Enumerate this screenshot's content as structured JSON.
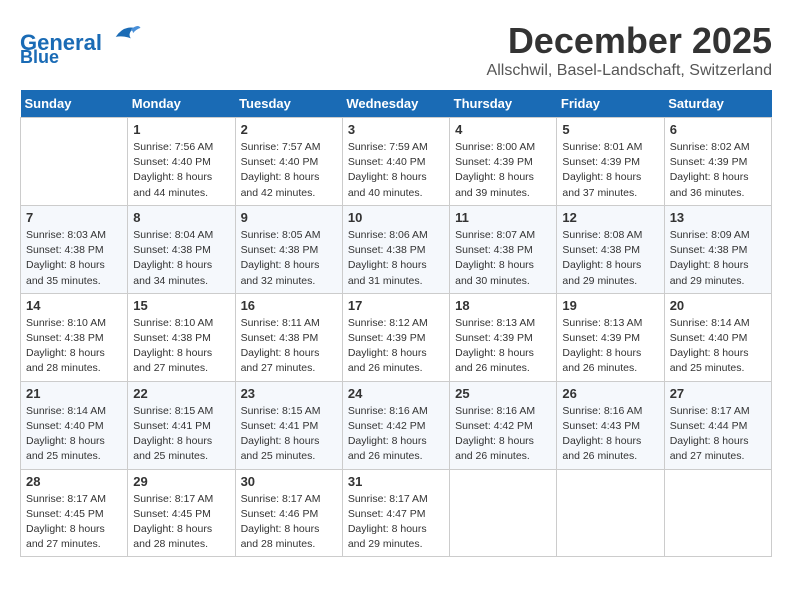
{
  "logo": {
    "line1": "General",
    "line2": "Blue"
  },
  "title": "December 2025",
  "location": "Allschwil, Basel-Landschaft, Switzerland",
  "days_of_week": [
    "Sunday",
    "Monday",
    "Tuesday",
    "Wednesday",
    "Thursday",
    "Friday",
    "Saturday"
  ],
  "weeks": [
    [
      {
        "day": "",
        "info": ""
      },
      {
        "day": "1",
        "info": "Sunrise: 7:56 AM\nSunset: 4:40 PM\nDaylight: 8 hours\nand 44 minutes."
      },
      {
        "day": "2",
        "info": "Sunrise: 7:57 AM\nSunset: 4:40 PM\nDaylight: 8 hours\nand 42 minutes."
      },
      {
        "day": "3",
        "info": "Sunrise: 7:59 AM\nSunset: 4:40 PM\nDaylight: 8 hours\nand 40 minutes."
      },
      {
        "day": "4",
        "info": "Sunrise: 8:00 AM\nSunset: 4:39 PM\nDaylight: 8 hours\nand 39 minutes."
      },
      {
        "day": "5",
        "info": "Sunrise: 8:01 AM\nSunset: 4:39 PM\nDaylight: 8 hours\nand 37 minutes."
      },
      {
        "day": "6",
        "info": "Sunrise: 8:02 AM\nSunset: 4:39 PM\nDaylight: 8 hours\nand 36 minutes."
      }
    ],
    [
      {
        "day": "7",
        "info": "Sunrise: 8:03 AM\nSunset: 4:38 PM\nDaylight: 8 hours\nand 35 minutes."
      },
      {
        "day": "8",
        "info": "Sunrise: 8:04 AM\nSunset: 4:38 PM\nDaylight: 8 hours\nand 34 minutes."
      },
      {
        "day": "9",
        "info": "Sunrise: 8:05 AM\nSunset: 4:38 PM\nDaylight: 8 hours\nand 32 minutes."
      },
      {
        "day": "10",
        "info": "Sunrise: 8:06 AM\nSunset: 4:38 PM\nDaylight: 8 hours\nand 31 minutes."
      },
      {
        "day": "11",
        "info": "Sunrise: 8:07 AM\nSunset: 4:38 PM\nDaylight: 8 hours\nand 30 minutes."
      },
      {
        "day": "12",
        "info": "Sunrise: 8:08 AM\nSunset: 4:38 PM\nDaylight: 8 hours\nand 29 minutes."
      },
      {
        "day": "13",
        "info": "Sunrise: 8:09 AM\nSunset: 4:38 PM\nDaylight: 8 hours\nand 29 minutes."
      }
    ],
    [
      {
        "day": "14",
        "info": "Sunrise: 8:10 AM\nSunset: 4:38 PM\nDaylight: 8 hours\nand 28 minutes."
      },
      {
        "day": "15",
        "info": "Sunrise: 8:10 AM\nSunset: 4:38 PM\nDaylight: 8 hours\nand 27 minutes."
      },
      {
        "day": "16",
        "info": "Sunrise: 8:11 AM\nSunset: 4:38 PM\nDaylight: 8 hours\nand 27 minutes."
      },
      {
        "day": "17",
        "info": "Sunrise: 8:12 AM\nSunset: 4:39 PM\nDaylight: 8 hours\nand 26 minutes."
      },
      {
        "day": "18",
        "info": "Sunrise: 8:13 AM\nSunset: 4:39 PM\nDaylight: 8 hours\nand 26 minutes."
      },
      {
        "day": "19",
        "info": "Sunrise: 8:13 AM\nSunset: 4:39 PM\nDaylight: 8 hours\nand 26 minutes."
      },
      {
        "day": "20",
        "info": "Sunrise: 8:14 AM\nSunset: 4:40 PM\nDaylight: 8 hours\nand 25 minutes."
      }
    ],
    [
      {
        "day": "21",
        "info": "Sunrise: 8:14 AM\nSunset: 4:40 PM\nDaylight: 8 hours\nand 25 minutes."
      },
      {
        "day": "22",
        "info": "Sunrise: 8:15 AM\nSunset: 4:41 PM\nDaylight: 8 hours\nand 25 minutes."
      },
      {
        "day": "23",
        "info": "Sunrise: 8:15 AM\nSunset: 4:41 PM\nDaylight: 8 hours\nand 25 minutes."
      },
      {
        "day": "24",
        "info": "Sunrise: 8:16 AM\nSunset: 4:42 PM\nDaylight: 8 hours\nand 26 minutes."
      },
      {
        "day": "25",
        "info": "Sunrise: 8:16 AM\nSunset: 4:42 PM\nDaylight: 8 hours\nand 26 minutes."
      },
      {
        "day": "26",
        "info": "Sunrise: 8:16 AM\nSunset: 4:43 PM\nDaylight: 8 hours\nand 26 minutes."
      },
      {
        "day": "27",
        "info": "Sunrise: 8:17 AM\nSunset: 4:44 PM\nDaylight: 8 hours\nand 27 minutes."
      }
    ],
    [
      {
        "day": "28",
        "info": "Sunrise: 8:17 AM\nSunset: 4:45 PM\nDaylight: 8 hours\nand 27 minutes."
      },
      {
        "day": "29",
        "info": "Sunrise: 8:17 AM\nSunset: 4:45 PM\nDaylight: 8 hours\nand 28 minutes."
      },
      {
        "day": "30",
        "info": "Sunrise: 8:17 AM\nSunset: 4:46 PM\nDaylight: 8 hours\nand 28 minutes."
      },
      {
        "day": "31",
        "info": "Sunrise: 8:17 AM\nSunset: 4:47 PM\nDaylight: 8 hours\nand 29 minutes."
      },
      {
        "day": "",
        "info": ""
      },
      {
        "day": "",
        "info": ""
      },
      {
        "day": "",
        "info": ""
      }
    ]
  ]
}
